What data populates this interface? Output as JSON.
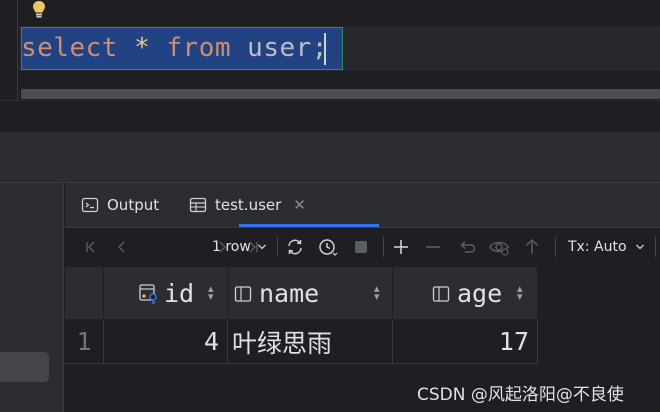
{
  "editor": {
    "code_keyword_select": "select",
    "code_star": "*",
    "code_keyword_from": "from",
    "code_table": "user",
    "code_semicolon": ";"
  },
  "tabs": [
    {
      "label": "Output",
      "icon": "console-icon",
      "active": false
    },
    {
      "label": "test.user",
      "icon": "table-icon",
      "active": true,
      "closable": true
    }
  ],
  "toolbar": {
    "page_size": "1 row",
    "tx_mode": "Tx: Auto"
  },
  "grid": {
    "columns": [
      {
        "name": "id",
        "icon": "primary-key-column-icon"
      },
      {
        "name": "name",
        "icon": "column-icon"
      },
      {
        "name": "age",
        "icon": "column-icon"
      }
    ],
    "rows": [
      {
        "num": "1",
        "id": "4",
        "name": "叶绿思雨",
        "age": "17"
      }
    ]
  },
  "watermark": "CSDN @风起洛阳@不良使",
  "colors": {
    "accent": "#3574f0",
    "selection": "#214283",
    "keyword": "#cf8e6d",
    "operator": "#f0c57c"
  }
}
